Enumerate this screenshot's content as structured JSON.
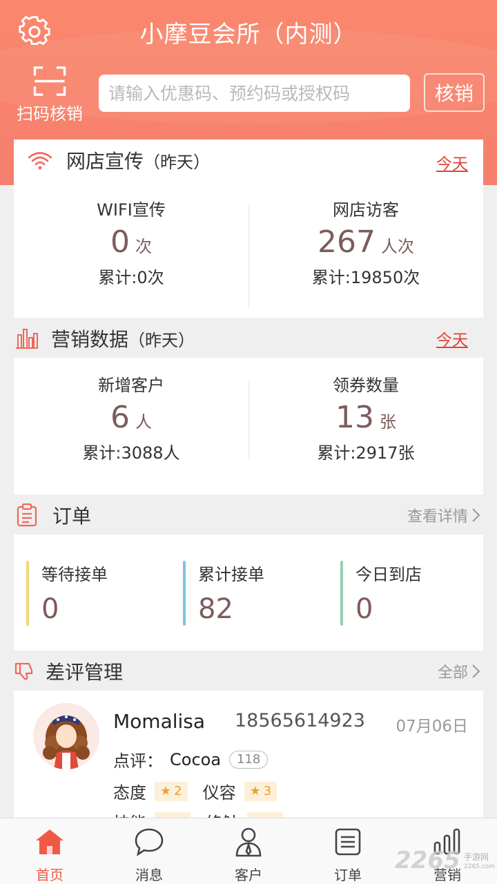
{
  "header": {
    "title": "小摩豆会所（内测）",
    "scan_label": "扫码核销",
    "search_placeholder": "请输入优惠码、预约码或授权码",
    "verify_label": "核销"
  },
  "promo": {
    "title": "网店宣传",
    "sub": "（昨天）",
    "link": "今天",
    "left": {
      "label": "WIFI宣传",
      "value": "0",
      "unit": "次",
      "total": "累计:0次"
    },
    "right": {
      "label": "网店访客",
      "value": "267",
      "unit": "人次",
      "total": "累计:19850次"
    }
  },
  "marketing": {
    "title": "营销数据",
    "sub": "（昨天）",
    "link": "今天",
    "left": {
      "label": "新增客户",
      "value": "6",
      "unit": "人",
      "total": "累计:3088人"
    },
    "right": {
      "label": "领券数量",
      "value": "13",
      "unit": "张",
      "total": "累计:2917张"
    }
  },
  "orders": {
    "title": "订单",
    "more": "查看详情",
    "items": [
      {
        "label": "等待接单",
        "value": "0",
        "color": "#f2d575"
      },
      {
        "label": "累计接单",
        "value": "82",
        "color": "#7ec0ea"
      },
      {
        "label": "今日到店",
        "value": "0",
        "color": "#8fd2b0"
      }
    ]
  },
  "reviews": {
    "title": "差评管理",
    "more": "全部",
    "item": {
      "name": "Momalisa",
      "phone": "18565614923",
      "date": "07月06日",
      "comment_label": "点评：",
      "shop": "Cocoa",
      "count": "118",
      "attitude_label": "态度",
      "attitude_score": "2",
      "appearance_label": "仪容",
      "appearance_score": "3",
      "skill_label": "技能",
      "env_label": "终触"
    }
  },
  "tabs": [
    {
      "label": "首页",
      "active": true
    },
    {
      "label": "消息"
    },
    {
      "label": "客户"
    },
    {
      "label": "订单"
    },
    {
      "label": "营销"
    }
  ],
  "watermark": {
    "brand": "2265",
    "sub": "手游网",
    "url": "2265.com"
  },
  "colors": {
    "accent": "#f8826c",
    "link": "#e0433b",
    "value": "#7d5c5b"
  }
}
